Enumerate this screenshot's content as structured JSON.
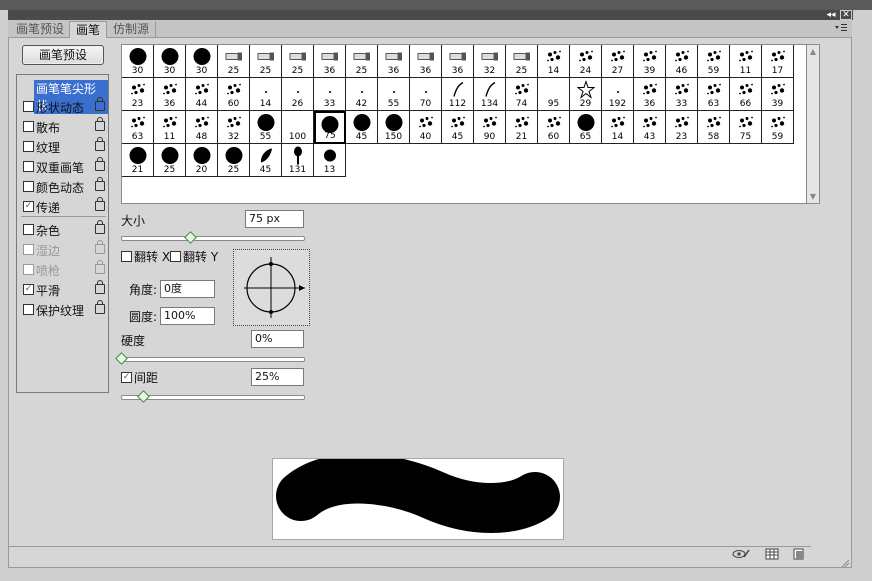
{
  "window": {
    "collapse_glyph": "◂◂",
    "close_glyph": "✕"
  },
  "tabs": [
    {
      "label": "画笔预设",
      "active": false
    },
    {
      "label": "画笔",
      "active": true
    },
    {
      "label": "仿制源",
      "active": false
    }
  ],
  "panel_menu_icon": "panel-menu-icon",
  "preset_button": "画笔预设",
  "left_list": [
    {
      "label": "画笔笔尖形状",
      "checkbox": false,
      "checked": false,
      "lock": false,
      "header": true,
      "disabled": false
    },
    {
      "label": "形状动态",
      "checkbox": true,
      "checked": false,
      "lock": true,
      "disabled": false
    },
    {
      "label": "散布",
      "checkbox": true,
      "checked": false,
      "lock": true,
      "disabled": false
    },
    {
      "label": "纹理",
      "checkbox": true,
      "checked": false,
      "lock": true,
      "disabled": false
    },
    {
      "label": "双重画笔",
      "checkbox": true,
      "checked": false,
      "lock": true,
      "disabled": false
    },
    {
      "label": "颜色动态",
      "checkbox": true,
      "checked": false,
      "lock": true,
      "disabled": false
    },
    {
      "label": "传递",
      "checkbox": true,
      "checked": true,
      "lock": true,
      "disabled": false
    },
    {
      "label": "杂色",
      "checkbox": true,
      "checked": false,
      "lock": true,
      "disabled": false
    },
    {
      "label": "湿边",
      "checkbox": true,
      "checked": false,
      "lock": true,
      "disabled": true
    },
    {
      "label": "喷枪",
      "checkbox": true,
      "checked": false,
      "lock": true,
      "disabled": true
    },
    {
      "label": "平滑",
      "checkbox": true,
      "checked": true,
      "lock": true,
      "disabled": false
    },
    {
      "label": "保护纹理",
      "checkbox": true,
      "checked": false,
      "lock": true,
      "disabled": false
    }
  ],
  "brush_tips": [
    {
      "size": "30",
      "shape": "hard"
    },
    {
      "size": "30",
      "shape": "hard"
    },
    {
      "size": "30",
      "shape": "hard"
    },
    {
      "size": "25",
      "shape": "tool"
    },
    {
      "size": "25",
      "shape": "tool"
    },
    {
      "size": "25",
      "shape": "tool"
    },
    {
      "size": "36",
      "shape": "tool"
    },
    {
      "size": "25",
      "shape": "tool"
    },
    {
      "size": "36",
      "shape": "tool"
    },
    {
      "size": "36",
      "shape": "tool"
    },
    {
      "size": "36",
      "shape": "tool"
    },
    {
      "size": "32",
      "shape": "tool"
    },
    {
      "size": "25",
      "shape": "tool"
    },
    {
      "size": "14",
      "shape": "splat"
    },
    {
      "size": "24",
      "shape": "splat"
    },
    {
      "size": "27",
      "shape": "splat"
    },
    {
      "size": "39",
      "shape": "splat"
    },
    {
      "size": "46",
      "shape": "splat"
    },
    {
      "size": "59",
      "shape": "splat"
    },
    {
      "size": "11",
      "shape": "splat"
    },
    {
      "size": "17",
      "shape": "splat"
    },
    {
      "size": "23",
      "shape": "splat"
    },
    {
      "size": "36",
      "shape": "splat"
    },
    {
      "size": "44",
      "shape": "splat"
    },
    {
      "size": "60",
      "shape": "splat"
    },
    {
      "size": "14",
      "shape": "dot"
    },
    {
      "size": "26",
      "shape": "dot"
    },
    {
      "size": "33",
      "shape": "dot"
    },
    {
      "size": "42",
      "shape": "dot"
    },
    {
      "size": "55",
      "shape": "dot"
    },
    {
      "size": "70",
      "shape": "dot"
    },
    {
      "size": "112",
      "shape": "curve"
    },
    {
      "size": "134",
      "shape": "curve"
    },
    {
      "size": "74",
      "shape": "splat"
    },
    {
      "size": "95",
      "shape": "none"
    },
    {
      "size": "29",
      "shape": "star"
    },
    {
      "size": "192",
      "shape": "dot"
    },
    {
      "size": "36",
      "shape": "splat"
    },
    {
      "size": "33",
      "shape": "splat"
    },
    {
      "size": "63",
      "shape": "splat"
    },
    {
      "size": "66",
      "shape": "splat"
    },
    {
      "size": "39",
      "shape": "splat"
    },
    {
      "size": "63",
      "shape": "splat"
    },
    {
      "size": "11",
      "shape": "splat"
    },
    {
      "size": "48",
      "shape": "splat"
    },
    {
      "size": "32",
      "shape": "splat"
    },
    {
      "size": "55",
      "shape": "hard"
    },
    {
      "size": "100",
      "shape": "none"
    },
    {
      "size": "75",
      "shape": "hard"
    },
    {
      "size": "45",
      "shape": "hard"
    },
    {
      "size": "150",
      "shape": "hard"
    },
    {
      "size": "40",
      "shape": "splat"
    },
    {
      "size": "45",
      "shape": "splat"
    },
    {
      "size": "90",
      "shape": "splat"
    },
    {
      "size": "21",
      "shape": "splat"
    },
    {
      "size": "60",
      "shape": "splat"
    },
    {
      "size": "65",
      "shape": "hard"
    },
    {
      "size": "14",
      "shape": "splat"
    },
    {
      "size": "43",
      "shape": "splat"
    },
    {
      "size": "23",
      "shape": "splat"
    },
    {
      "size": "58",
      "shape": "splat"
    },
    {
      "size": "75",
      "shape": "splat"
    },
    {
      "size": "59",
      "shape": "splat"
    },
    {
      "size": "21",
      "shape": "hard"
    },
    {
      "size": "25",
      "shape": "hard"
    },
    {
      "size": "20",
      "shape": "hard"
    },
    {
      "size": "25",
      "shape": "hard"
    },
    {
      "size": "45",
      "shape": "leaf"
    },
    {
      "size": "131",
      "shape": "drop"
    },
    {
      "size": "13",
      "shape": "hard-small"
    }
  ],
  "selected_tip_index": 48,
  "size": {
    "label": "大小",
    "value": "75 px",
    "slider_fraction": 0.38
  },
  "flip": {
    "x_label": "翻转 X",
    "y_label": "翻转 Y",
    "x_checked": false,
    "y_checked": false
  },
  "angle": {
    "label": "角度:",
    "value": "0度"
  },
  "roundness": {
    "label": "圆度:",
    "value": "100%"
  },
  "hardness": {
    "label": "硬度",
    "value": "0%",
    "slider_fraction": 0.0
  },
  "spacing": {
    "label": "间距",
    "value": "25%",
    "checked": true,
    "slider_fraction": 0.12
  },
  "bottom_icons": [
    "eye-brush-icon",
    "grid-icon",
    "new-preset-icon"
  ]
}
